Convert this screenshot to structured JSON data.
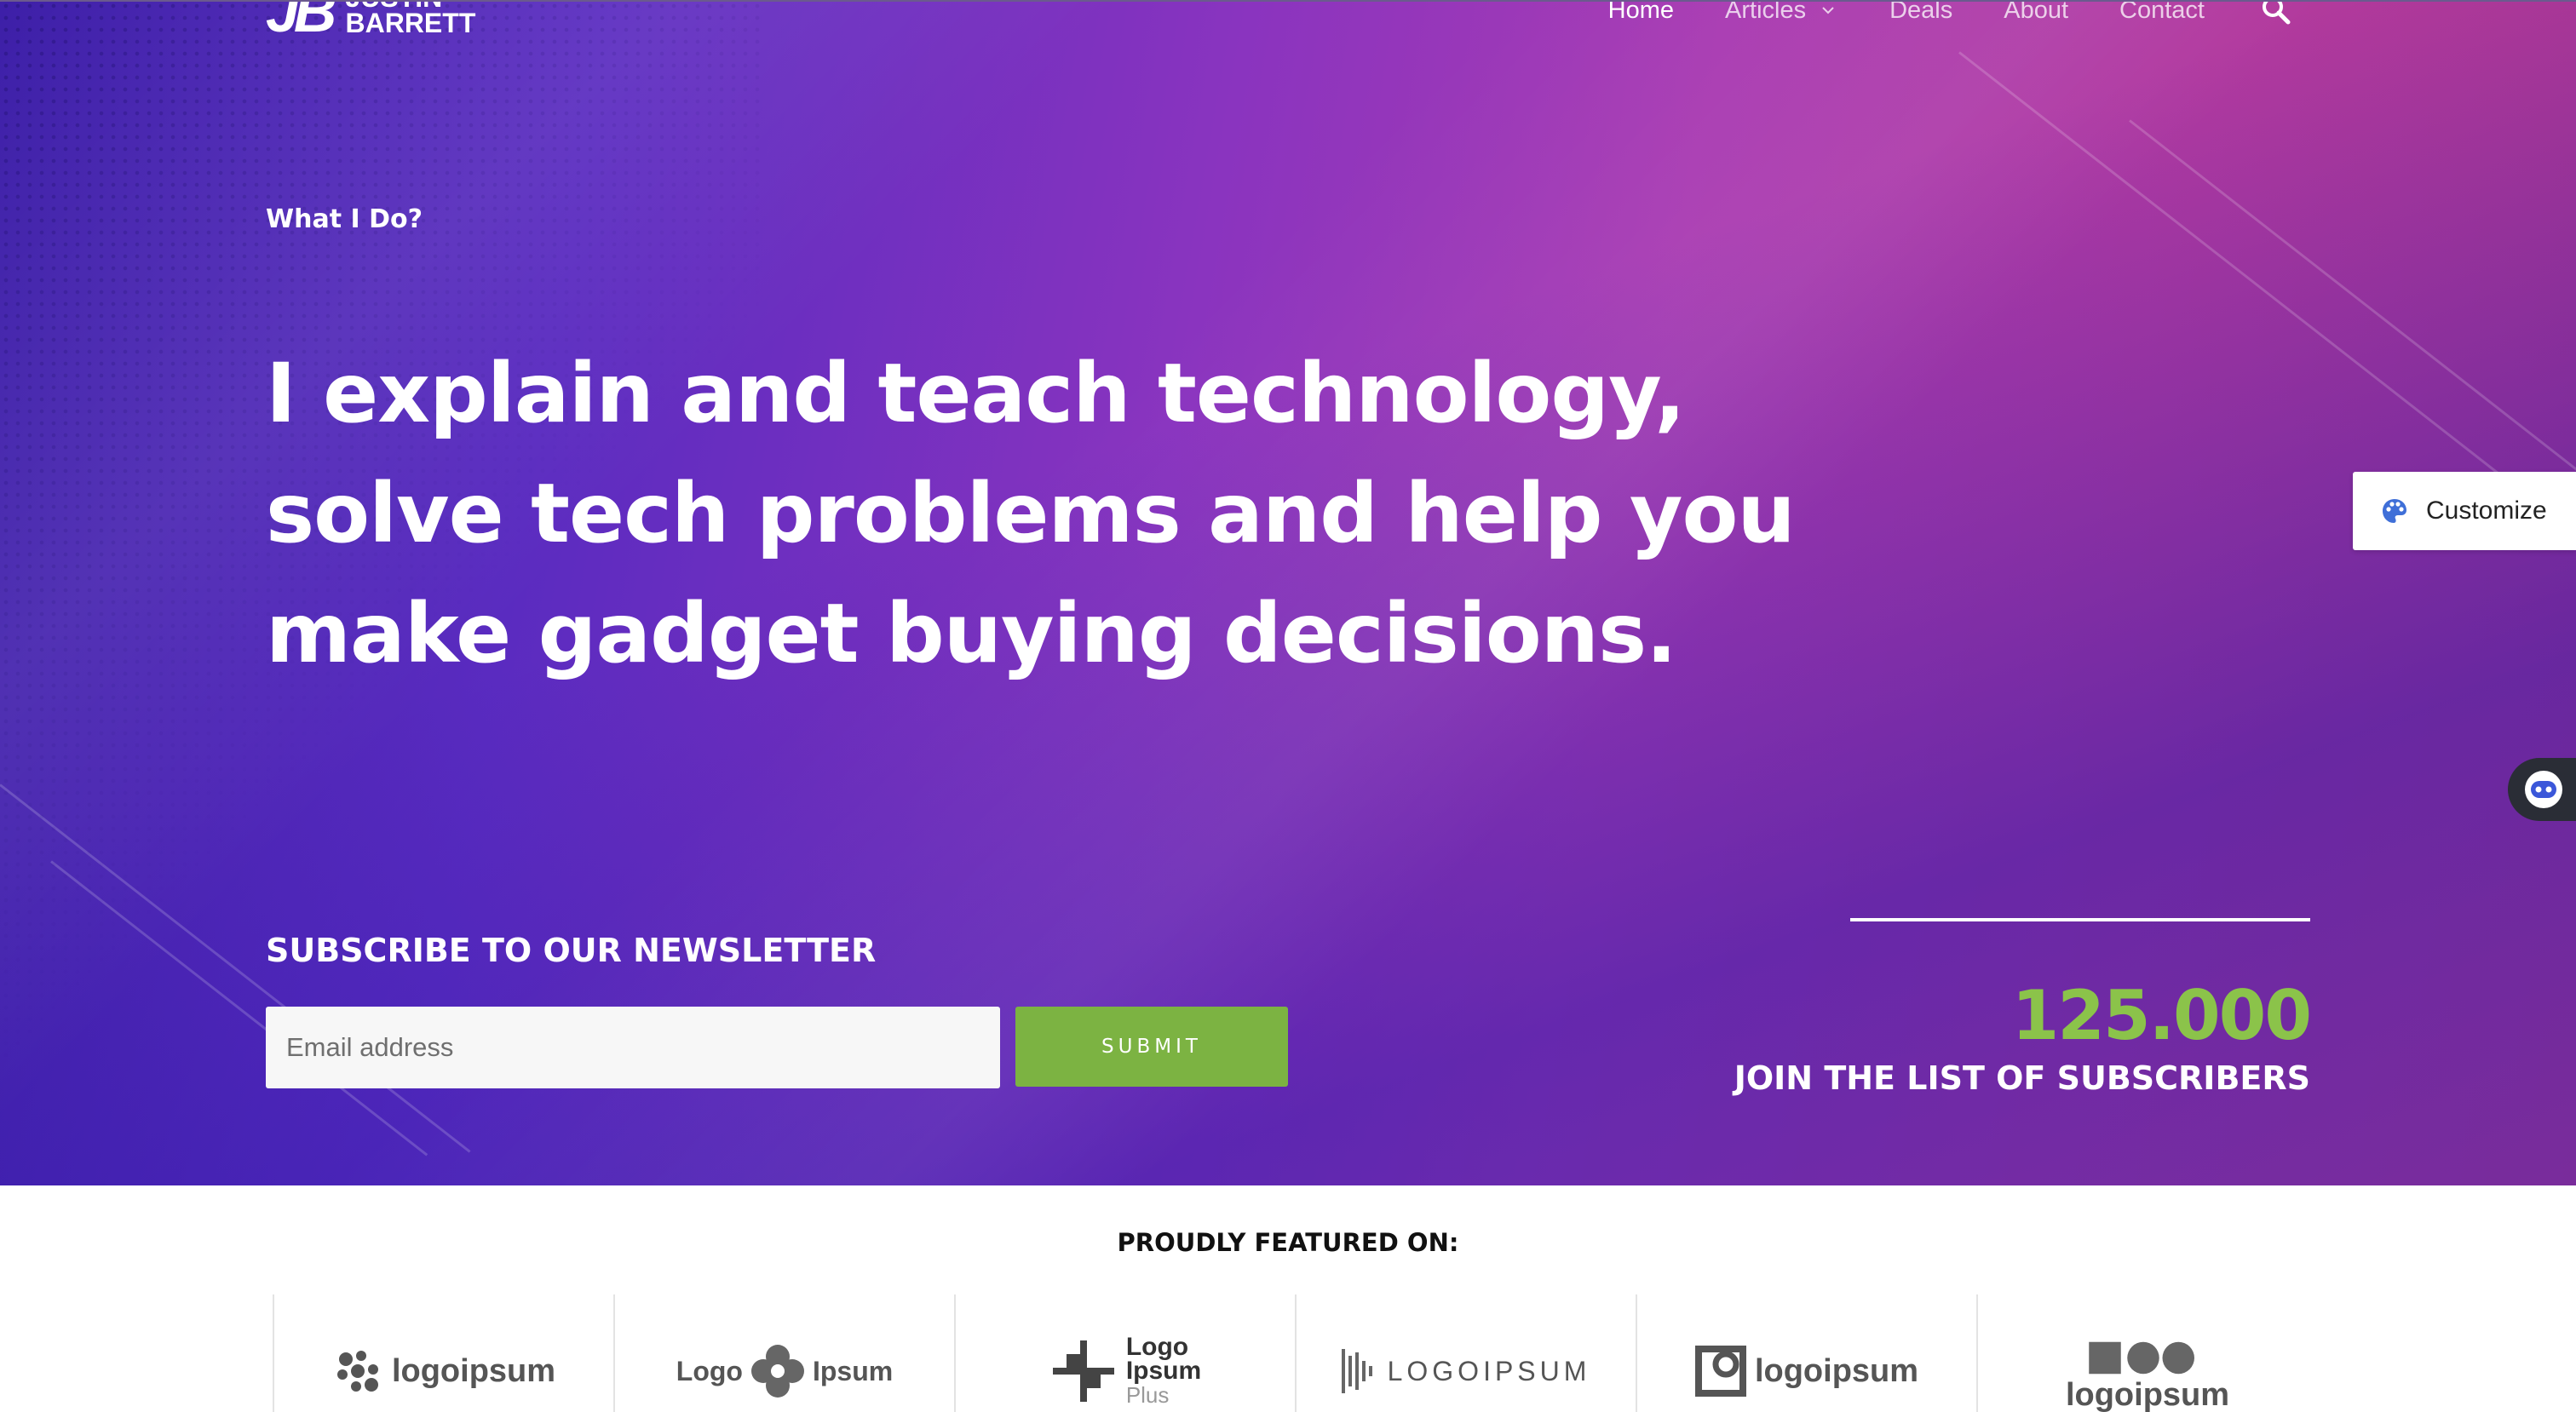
{
  "header": {
    "logo_mark": "JB",
    "logo_line1": "JUSTIN",
    "logo_line2": "BARRETT",
    "nav": [
      {
        "label": "Home",
        "active": true
      },
      {
        "label": "Articles",
        "has_dropdown": true
      },
      {
        "label": "Deals"
      },
      {
        "label": "About"
      },
      {
        "label": "Contact"
      }
    ],
    "search_icon": "search-icon"
  },
  "hero": {
    "kicker": "What I Do?",
    "headline_lines": [
      "I explain and teach technology,",
      "solve tech problems and help you",
      "make gadget buying decisions."
    ]
  },
  "newsletter": {
    "title": "SUBSCRIBE TO OUR NEWSLETTER",
    "email_placeholder": "Email address",
    "submit_label": "SUBMIT"
  },
  "stats": {
    "number": "125.000",
    "label": "JOIN THE LIST OF SUBSCRIBERS"
  },
  "widgets": {
    "customize_label": "Customize",
    "customize_icon": "palette-icon",
    "assistant_icon": "robot-face-icon"
  },
  "featured": {
    "title": "PROUDLY FEATURED ON:",
    "logos": [
      {
        "text": "logoipsum",
        "style": "dots-mark"
      },
      {
        "text_left": "Logo",
        "text_right": "Ipsum",
        "style": "flower-mark"
      },
      {
        "line1": "Logo",
        "line2": "Ipsum",
        "line3": "Plus",
        "style": "cross-mark"
      },
      {
        "text": "LOGOIPSUM",
        "style": "bars-mark"
      },
      {
        "text": "logoipsum",
        "style": "square-mark"
      },
      {
        "text": "logoipsum",
        "style": "shapes-mark"
      }
    ]
  },
  "colors": {
    "accent_green": "#7cb342",
    "stat_green": "#8bc34a",
    "hero_purple": "#5a2bc0",
    "hero_magenta": "#b23a9f"
  }
}
